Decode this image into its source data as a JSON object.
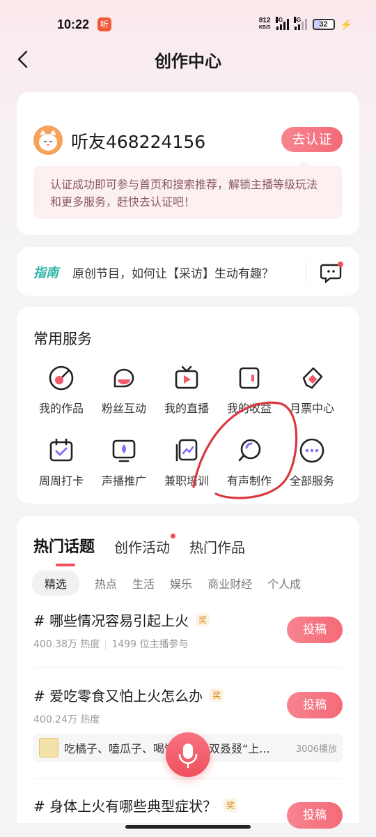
{
  "status_bar": {
    "time": "10:22",
    "app_icon_char": "听",
    "net_speed_value": "812",
    "net_speed_unit": "KB/S",
    "network_labels": [
      "4G",
      "5G"
    ],
    "battery": "32"
  },
  "nav": {
    "title": "创作中心"
  },
  "profile": {
    "username": "听友468224156",
    "verify_label": "去认证",
    "verify_tip": "认证成功即可参与首页和搜索推荐，解锁主播等级玩法和更多服务，赶快去认证吧！"
  },
  "guide": {
    "tag": "指南",
    "text": "原创节目，如何让【采访】生动有趣？"
  },
  "services": {
    "title": "常用服务",
    "items": [
      {
        "label": "我的作品",
        "icon": "record-icon"
      },
      {
        "label": "粉丝互动",
        "icon": "chat-bubble-icon"
      },
      {
        "label": "我的直播",
        "icon": "tv-play-icon"
      },
      {
        "label": "我的收益",
        "icon": "wallet-icon"
      },
      {
        "label": "月票中心",
        "icon": "ticket-icon"
      },
      {
        "label": "周周打卡",
        "icon": "calendar-check-icon"
      },
      {
        "label": "声播推广",
        "icon": "promote-screen-icon"
      },
      {
        "label": "兼职培训",
        "icon": "training-board-icon"
      },
      {
        "label": "有声制作",
        "icon": "audio-produce-icon"
      },
      {
        "label": "全部服务",
        "icon": "more-icon"
      }
    ]
  },
  "hot": {
    "tabs": [
      "热门话题",
      "创作活动",
      "热门作品"
    ],
    "chips": [
      "精选",
      "热点",
      "生活",
      "娱乐",
      "商业财经",
      "个人成"
    ],
    "topics": [
      {
        "title": "# 哪些情况容易引起上火",
        "badge": "奖",
        "heat": "400.38万 热度",
        "participants": "1499 位主播参与",
        "button": "投稿"
      },
      {
        "title": "# 爱吃零食又怕上火怎么办",
        "badge": "奖",
        "heat": "400.24万 热度",
        "participants": "",
        "button": "投稿",
        "media": {
          "text": "吃橘子、嗑瓜子、喝饮料！又双叒叕“上...",
          "plays": "3006播放"
        }
      },
      {
        "title": "# 身体上火有哪些典型症状？",
        "badge": "奖",
        "heat": "",
        "participants": "",
        "button": "投稿"
      }
    ]
  },
  "colors": {
    "accent": "#f46a78",
    "guide_tag": "#2db5a5",
    "annotation": "#d9393f"
  }
}
